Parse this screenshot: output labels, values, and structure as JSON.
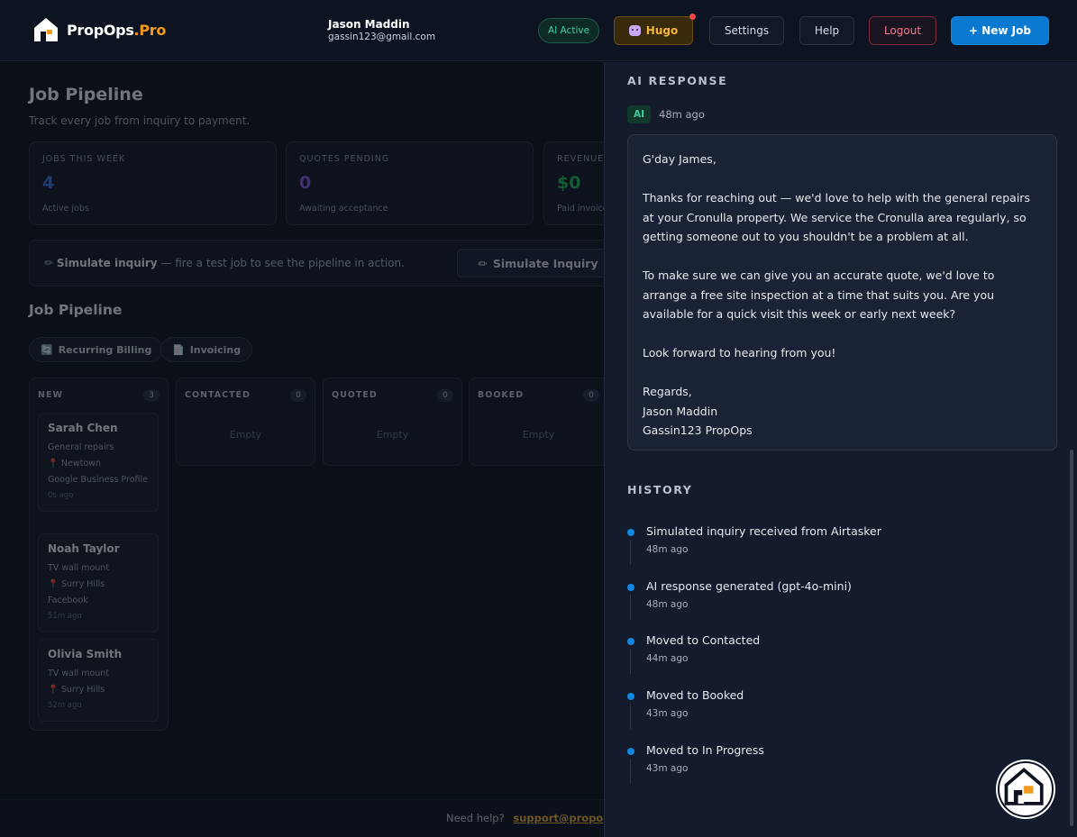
{
  "header": {
    "brand_main": "PropOps",
    "brand_accent": ".Pro",
    "user_name": "Jason Maddin",
    "user_email": "gassin123@gmail.com",
    "ai_status": "AI Active",
    "hugo_label": "Hugo",
    "settings_label": "Settings",
    "help_label": "Help",
    "logout_label": "Logout",
    "new_job_label": "+ New Job"
  },
  "page": {
    "title": "Job Pipeline",
    "subtitle": "Track every job from inquiry to payment."
  },
  "stats": [
    {
      "label": "JOBS THIS WEEK",
      "value": "4",
      "sub": "Active jobs",
      "color": "#3d7be0"
    },
    {
      "label": "QUOTES PENDING",
      "value": "0",
      "sub": "Awaiting acceptance",
      "color": "#8b5cf6"
    },
    {
      "label": "REVENUE",
      "value": "$0",
      "sub": "Paid invoices",
      "color": "#22c55e"
    }
  ],
  "simulate": {
    "title": "Simulate inquiry",
    "desc": " — fire a test job to see the pipeline in action.",
    "button_label": "Simulate Inquiry"
  },
  "pipeline": {
    "title": "Job Pipeline",
    "chips": [
      "Recurring Billing",
      "Invoicing"
    ],
    "columns": [
      {
        "name": "NEW",
        "count": "3"
      },
      {
        "name": "CONTACTED",
        "count": "0",
        "empty": "Empty"
      },
      {
        "name": "QUOTED",
        "count": "0",
        "empty": "Empty"
      },
      {
        "name": "BOOKED",
        "count": "0",
        "empty": "Empty"
      }
    ],
    "cards": [
      {
        "name": "Sarah Chen",
        "service": "General repairs",
        "location": "Newtown",
        "source": "Google Business Profile",
        "time": "0s ago"
      },
      {
        "name": "Noah Taylor",
        "service": "TV wall mount",
        "location": "Surry Hills",
        "source": "Facebook",
        "time": "51m ago"
      },
      {
        "name": "Olivia Smith",
        "service": "TV wall mount",
        "location": "Surry Hills",
        "time": "52m ago"
      }
    ]
  },
  "footer": {
    "help_text": "Need help?",
    "support_link": "support@propop"
  },
  "panel": {
    "ai_response_title": "AI RESPONSE",
    "ai_tag": "AI",
    "ai_time": "48m ago",
    "response": {
      "greeting": "G'day James,",
      "para1": "Thanks for reaching out — we'd love to help with the general repairs at your Cronulla property. We service the Cronulla area regularly, so getting someone out to you shouldn't be a problem at all.",
      "para2": "To make sure we can give you an accurate quote, we'd love to arrange a free site inspection at a time that suits you. Are you available for a quick visit this week or early next week?",
      "para3": "Look forward to hearing from you!",
      "signoff": "Regards,",
      "sig_name": "Jason Maddin",
      "sig_company": "Gassin123 PropOps"
    },
    "history_title": "HISTORY",
    "history": [
      {
        "event": "Simulated inquiry received from Airtasker",
        "time": "48m ago"
      },
      {
        "event": "AI response generated (gpt-4o-mini)",
        "time": "48m ago"
      },
      {
        "event": "Moved to Contacted",
        "time": "44m ago"
      },
      {
        "event": "Moved to Booked",
        "time": "43m ago"
      },
      {
        "event": "Moved to In Progress",
        "time": "43m ago"
      }
    ]
  }
}
